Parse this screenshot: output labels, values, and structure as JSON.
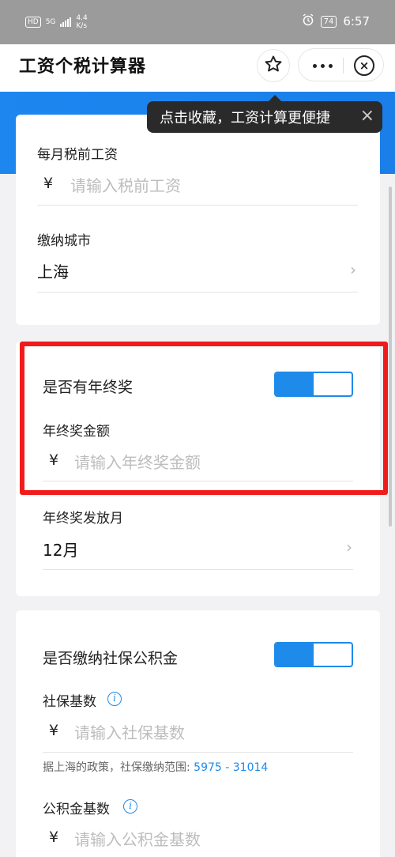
{
  "status_bar": {
    "hd": "HD",
    "network": "5G",
    "speed_value": "4.4",
    "speed_unit": "K/s",
    "battery": "74",
    "time": "6:57",
    "alarm_icon": "alarm-clock-icon"
  },
  "titlebar": {
    "title": "工资个税计算器",
    "star_icon": "star-icon",
    "more_icon": "more-dots-icon",
    "close_icon": "close-circle-icon"
  },
  "tooltip": {
    "text": "点击收藏，工资计算更便捷",
    "close": "×"
  },
  "salary_card": {
    "monthly_label": "每月税前工资",
    "currency": "¥",
    "monthly_placeholder": "请输入税前工资",
    "city_label": "缴纳城市",
    "city_value": "上海"
  },
  "bonus_card": {
    "has_bonus_label": "是否有年终奖",
    "has_bonus_on": true,
    "amount_label": "年终奖金额",
    "currency": "¥",
    "amount_placeholder": "请输入年终奖金额",
    "month_label": "年终奖发放月",
    "month_value": "12月"
  },
  "social_card": {
    "pay_label": "是否缴纳社保公积金",
    "pay_on": true,
    "social_base_label": "社保基数",
    "currency": "¥",
    "social_base_placeholder": "请输入社保基数",
    "hint_prefix": "据上海的政策，社保缴纳范围: ",
    "hint_range": "5975 - 31014",
    "fund_base_label": "公积金基数",
    "fund_base_placeholder": "请输入公积金基数"
  },
  "colors": {
    "accent": "#1e8aea",
    "highlight": "#f21b1b",
    "tooltip_bg": "#2a2a2a"
  }
}
